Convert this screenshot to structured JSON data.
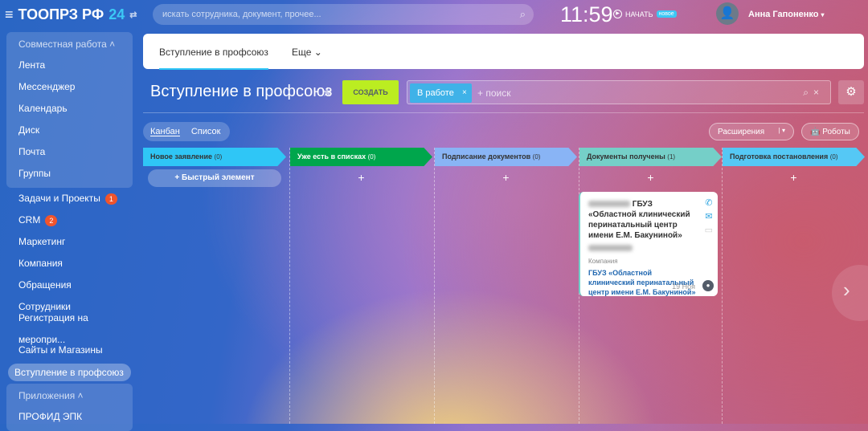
{
  "header": {
    "logo": "ТООПРЗ РФ",
    "logo_suffix": "24",
    "search_placeholder": "искать сотрудника, документ, прочее...",
    "time": "11:59",
    "start_label": "НАЧАТЬ",
    "new_badge": "новое",
    "user_name": "Анна Гапоненко"
  },
  "sidebar": {
    "group1": "Совместная работа",
    "group1_items": [
      "Лента",
      "Мессенджер",
      "Календарь",
      "Диск",
      "Почта",
      "Группы"
    ],
    "items": [
      {
        "label": "Задачи и Проекты",
        "count": "1"
      },
      {
        "label": "CRM",
        "count": "2"
      },
      {
        "label": "Маркетинг"
      },
      {
        "label": "Компания"
      },
      {
        "label": "Обращения"
      },
      {
        "label": "Сотрудники"
      },
      {
        "label": "Регистрация на меропри..."
      },
      {
        "label": "Сайты и Магазины"
      }
    ],
    "active": "Вступление в профсоюз",
    "group2": "Приложения",
    "group2_items": [
      "ПРОФИД ЭПК"
    ]
  },
  "tabs": {
    "active": "Вступление в профсоюз",
    "more": "Еще"
  },
  "page": {
    "title": "Вступление в профсоюз",
    "create": "СОЗДАТЬ",
    "filter_chip": "В работе",
    "search_placeholder": "+ поиск",
    "view_kanban": "Канбан",
    "view_list": "Список",
    "extensions": "Расширения",
    "robots": "Роботы",
    "quick_add": "Быстрый элемент"
  },
  "columns": [
    {
      "title": "Новое заявление",
      "count": "(0)",
      "color": "#2fc6f6"
    },
    {
      "title": "Уже есть в списках",
      "count": "(0)",
      "color": "#00a64c"
    },
    {
      "title": "Подписание документов",
      "count": "(0)",
      "color": "#89b4f5"
    },
    {
      "title": "Документы получены",
      "count": "(1)",
      "color": "#75cfc8"
    },
    {
      "title": "Подготовка постановления",
      "count": "(0)",
      "color": "#55c8f5"
    }
  ],
  "card": {
    "title": "ГБУЗ «Областной клинический перинатальный центр имени Е.М. Бакуниной»",
    "label": "Компания",
    "company": "ГБУЗ «Областной клинический перинатальный центр имени Е.М. Бакуниной»",
    "date": "19 Ноя"
  }
}
